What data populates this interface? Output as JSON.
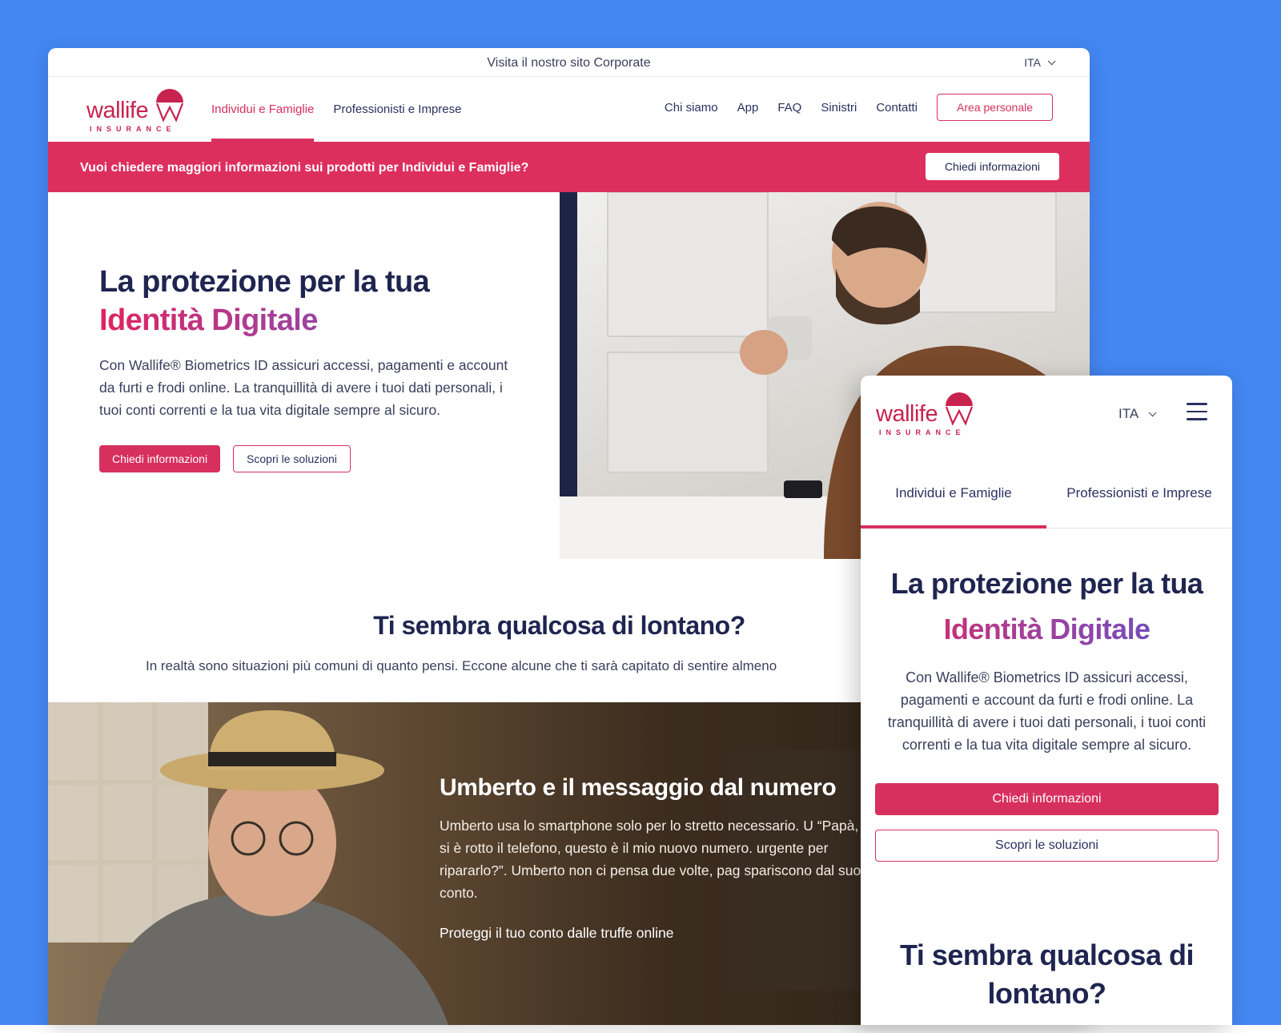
{
  "desktop": {
    "topbar": {
      "corporate_link": "Visita il nostro sito Corporate",
      "language": "ITA"
    },
    "logo": {
      "word": "wallife",
      "sub": "INSURANCE"
    },
    "nav_left": [
      {
        "label": "Individui e Famiglie",
        "active": true
      },
      {
        "label": "Professionisti e Imprese",
        "active": false
      }
    ],
    "nav_right": [
      "Chi siamo",
      "App",
      "FAQ",
      "Sinistri",
      "Contatti"
    ],
    "area_personale": "Area personale",
    "banner": {
      "text": "Vuoi chiedere maggiori informazioni sui prodotti per Individui e Famiglie?",
      "button": "Chiedi informazioni"
    },
    "hero": {
      "title_line1": "La protezione per la tua",
      "title_line2": "Identità Digitale",
      "paragraph": "Con Wallife® Biometrics ID assicuri accessi, pagamenti e account da furti e frodi online. La tranquillità di avere i tuoi dati personali, i tuoi conti correnti e la tua vita digitale sempre al sicuro.",
      "primary_button": "Chiedi informazioni",
      "secondary_button": "Scopri le soluzioni"
    },
    "section2": {
      "title": "Ti sembra qualcosa di lontano?",
      "subtitle": "In realtà sono situazioni più comuni di quanto pensi. Eccone alcune che ti sarà capitato di sentire almeno"
    },
    "story": {
      "title": "Umberto e il messaggio dal numero",
      "paragraph": "Umberto usa lo smartphone solo per lo stretto necessario. U “Papà, mi si è rotto il telefono, questo è il mio nuovo numero. urgente per ripararlo?”. Umberto non ci pensa due volte, pag spariscono dal suo conto.",
      "link": "Proteggi il tuo conto dalle truffe online"
    }
  },
  "mobile": {
    "logo": {
      "word": "wallife",
      "sub": "INSURANCE"
    },
    "language": "ITA",
    "tabs": [
      {
        "label": "Individui e Famiglie",
        "active": true
      },
      {
        "label": "Professionisti e Imprese",
        "active": false
      }
    ],
    "hero": {
      "title_line1": "La protezione per la tua",
      "title_line2": "Identità Digitale",
      "paragraph": "Con Wallife® Biometrics ID assicuri accessi, pagamenti e account da furti e frodi online. La tranquillità di avere i tuoi dati personali, i tuoi conti correnti e la tua vita digitale sempre al sicuro.",
      "primary_button": "Chiedi informazioni",
      "secondary_button": "Scopri le soluzioni"
    },
    "section2_title": "Ti sembra qualcosa di lontano?"
  },
  "colors": {
    "brand_pink": "#d7305e",
    "navy": "#1f2550",
    "background_blue": "#4487f2"
  }
}
